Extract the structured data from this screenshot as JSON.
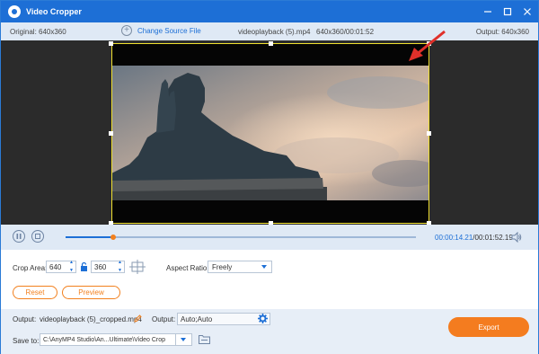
{
  "window": {
    "title": "Video Cropper",
    "controls": [
      "minimize-icon",
      "maximize-icon",
      "close-icon"
    ]
  },
  "infobar": {
    "original": "Original: 640x360",
    "change_source": "Change Source File",
    "filename": "videoplayback (5).mp4",
    "dims_time": "640x360/00:01:52",
    "output": "Output: 640x360"
  },
  "playback": {
    "time_current": "00:00:14.21",
    "time_separator": "/",
    "time_total": "00:01:52.19",
    "progress": 0.135
  },
  "crop": {
    "area_label": "Crop Area:",
    "width": "640",
    "height": "360",
    "aspect_label": "Aspect Ratio:",
    "aspect_value": "Freely",
    "reset_label": "Reset",
    "preview_label": "Preview"
  },
  "output": {
    "output_label": "Output:",
    "filename": "videoplayback (5)_cropped.mp4",
    "format_label": "Output:",
    "format_value": "Auto;Auto",
    "save_label": "Save to:",
    "save_path": "C:\\AnyMP4 Studio\\An...Ultimate\\Video Crop",
    "export_label": "Export"
  },
  "colors": {
    "accent": "#1d6fd6",
    "orange": "#f47c1f",
    "crop_border": "#f0e030"
  }
}
